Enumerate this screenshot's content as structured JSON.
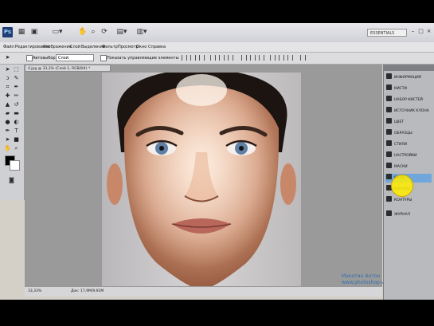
{
  "toolbar": {
    "logo": "Ps",
    "workspace": "ESSENTIALS"
  },
  "menu": [
    "Файл",
    "Редактирование",
    "Изображение",
    "Слой",
    "Выделение",
    "Фильтр",
    "Просмотр",
    "Окно",
    "Справка"
  ],
  "options": {
    "auto_select_label": "Автовыбор:",
    "auto_select_value": "Слой",
    "transform_label": "Показать управляющие элементы"
  },
  "document": {
    "tab_title": "4.jpg @ 33,3% (Слой 1, RGB/8#) *",
    "zoom": "33,33%",
    "doc_info": "Док: 17,9M/9,92M"
  },
  "watermark": {
    "author": "Макотин Антон",
    "site": "www.photoshop-video.com"
  },
  "panels": [
    {
      "label": "ИНФОРМАЦИЯ"
    },
    {
      "label": "КИСТИ"
    },
    {
      "label": "НАБОР КИСТЕЙ"
    },
    {
      "label": "ИСТОЧНИК КЛОНА"
    },
    {
      "label": "ЦВЕТ"
    },
    {
      "label": "ОБРАЗЦЫ"
    },
    {
      "label": "СТИЛИ"
    },
    {
      "label": "НАСТРОЙКИ"
    },
    {
      "label": "МАСКИ"
    },
    {
      "label": "СЛОИ",
      "selected": true
    },
    {
      "label": "КАНАЛЫ"
    },
    {
      "label": "КОНТУРЫ"
    },
    {
      "label": "ЖУРНАЛ"
    }
  ]
}
